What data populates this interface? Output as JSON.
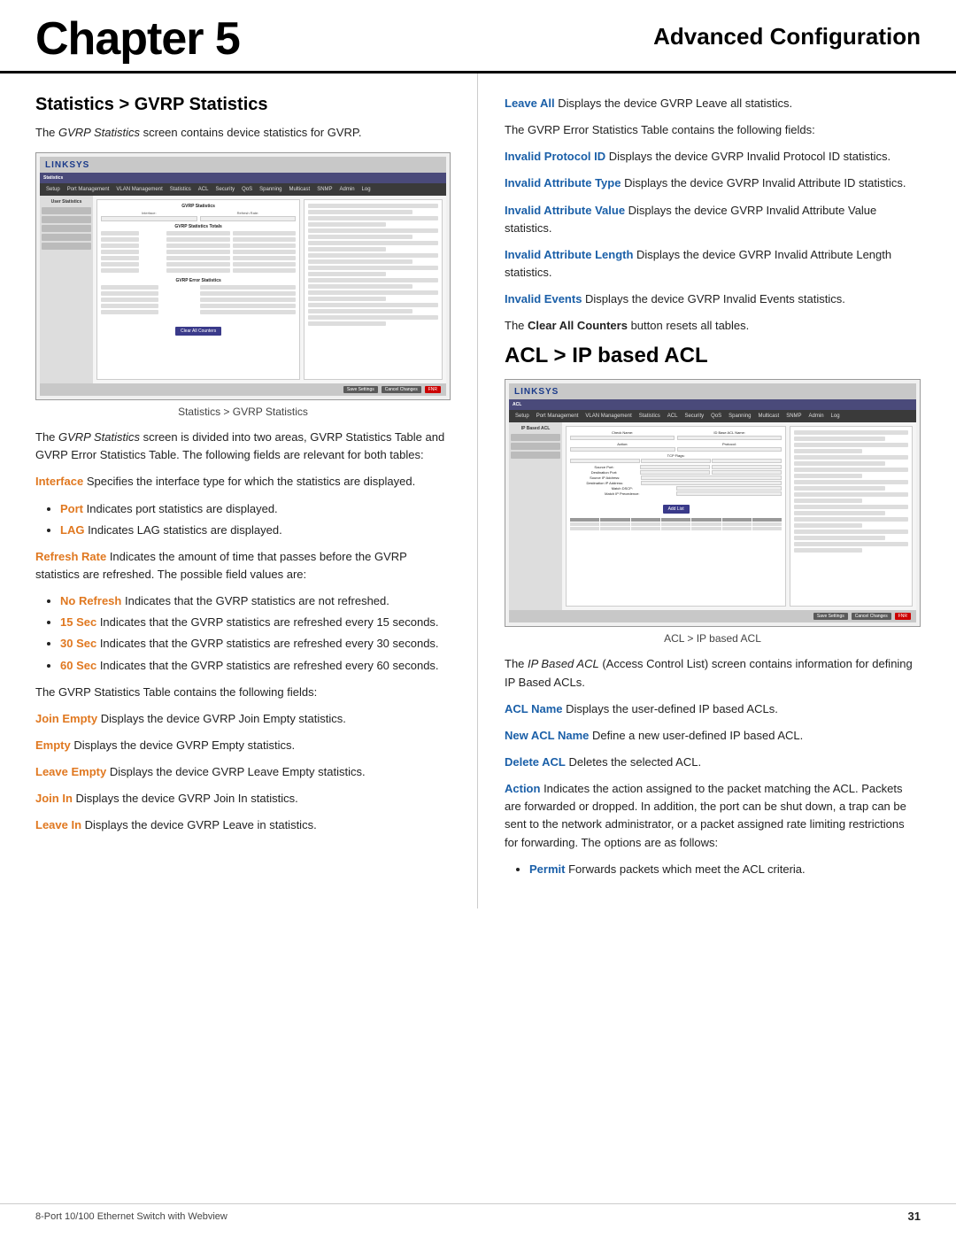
{
  "header": {
    "chapter_label": "Chapter 5",
    "section_label": "Advanced Configuration"
  },
  "left_col": {
    "section_heading": "Statistics > GVRP Statistics",
    "intro_text": "The GVRP Statistics screen contains device statistics for GVRP.",
    "screenshot_caption": "Statistics > GVRP Statistics",
    "para_after_screenshot": "The GVRP Statistics screen is divided into two areas, GVRP Statistics Table and GVRP Error Statistics Table. The following fields are relevant for both tables:",
    "interface_label": "Interface",
    "interface_desc": "Specifies the interface type for which the statistics are displayed.",
    "bullets_interface": [
      {
        "term": "Port",
        "desc": "Indicates port statistics are displayed."
      },
      {
        "term": "LAG",
        "desc": "Indicates LAG statistics are displayed."
      }
    ],
    "refresh_rate_label": "Refresh Rate",
    "refresh_rate_desc": "Indicates the amount of time that passes before the GVRP statistics are refreshed. The possible field values are:",
    "bullets_refresh": [
      {
        "term": "No Refresh",
        "desc": "Indicates that the GVRP statistics are not refreshed."
      },
      {
        "term": "15 Sec",
        "desc": "Indicates that the GVRP statistics are refreshed every 15 seconds."
      },
      {
        "term": "30 Sec",
        "desc": "Indicates that the GVRP statistics are refreshed every 30 seconds."
      },
      {
        "term": "60 Sec",
        "desc": "Indicates that the GVRP statistics are refreshed every 60 seconds."
      }
    ],
    "table_fields_intro": "The GVRP Statistics Table contains the following fields:",
    "fields": [
      {
        "term": "Join Empty",
        "desc": "Displays the device GVRP Join Empty statistics."
      },
      {
        "term": "Empty",
        "desc": "Displays the device GVRP Empty statistics."
      },
      {
        "term": "Leave Empty",
        "desc": "Displays the device GVRP Leave Empty statistics."
      },
      {
        "term": "Join In",
        "desc": "Displays the device GVRP Join In statistics."
      },
      {
        "term": "Leave In",
        "desc": "Displays the device GVRP Leave in statistics."
      }
    ]
  },
  "right_col": {
    "leave_all_label": "Leave All",
    "leave_all_desc": "Displays the device GVRP Leave all statistics.",
    "error_table_intro": "The GVRP Error Statistics Table contains the following fields:",
    "error_fields": [
      {
        "term": "Invalid Protocol ID",
        "desc": "Displays the device GVRP Invalid Protocol ID statistics."
      },
      {
        "term": "Invalid Attribute Type",
        "desc": "Displays the device GVRP Invalid Attribute ID statistics."
      },
      {
        "term": "Invalid Attribute Value",
        "desc": "Displays the device GVRP Invalid Attribute Value statistics."
      },
      {
        "term": "Invalid Attribute Length",
        "desc": "Displays the device GVRP Invalid Attribute Length statistics."
      },
      {
        "term": "Invalid Events",
        "desc": "Displays the device GVRP Invalid Events statistics."
      }
    ],
    "clear_all_counters_text": "The Clear All Counters button resets all tables.",
    "acl_heading": "ACL > IP based ACL",
    "acl_screenshot_caption": "ACL > IP based ACL",
    "acl_intro": "The IP Based ACL (Access Control List) screen contains information for defining IP Based ACLs.",
    "acl_fields": [
      {
        "term": "ACL Name",
        "desc": "Displays the user-defined IP based ACLs."
      },
      {
        "term": "New ACL Name",
        "desc": "Define a new user-defined IP based ACL."
      },
      {
        "term": "Delete ACL",
        "desc": "Deletes the selected ACL."
      },
      {
        "term": "Action",
        "desc": "Indicates the action assigned to the packet matching the ACL. Packets are forwarded or dropped. In addition, the port can be shut down, a trap can be sent to the network administrator, or a packet assigned rate limiting restrictions for forwarding. The options are as follows:"
      }
    ],
    "action_bullets": [
      {
        "term": "Permit",
        "desc": "Forwards packets which meet the ACL criteria."
      }
    ]
  },
  "footer": {
    "device_label": "8-Port 10/100 Ethernet Switch with Webview",
    "page_num": "31"
  }
}
